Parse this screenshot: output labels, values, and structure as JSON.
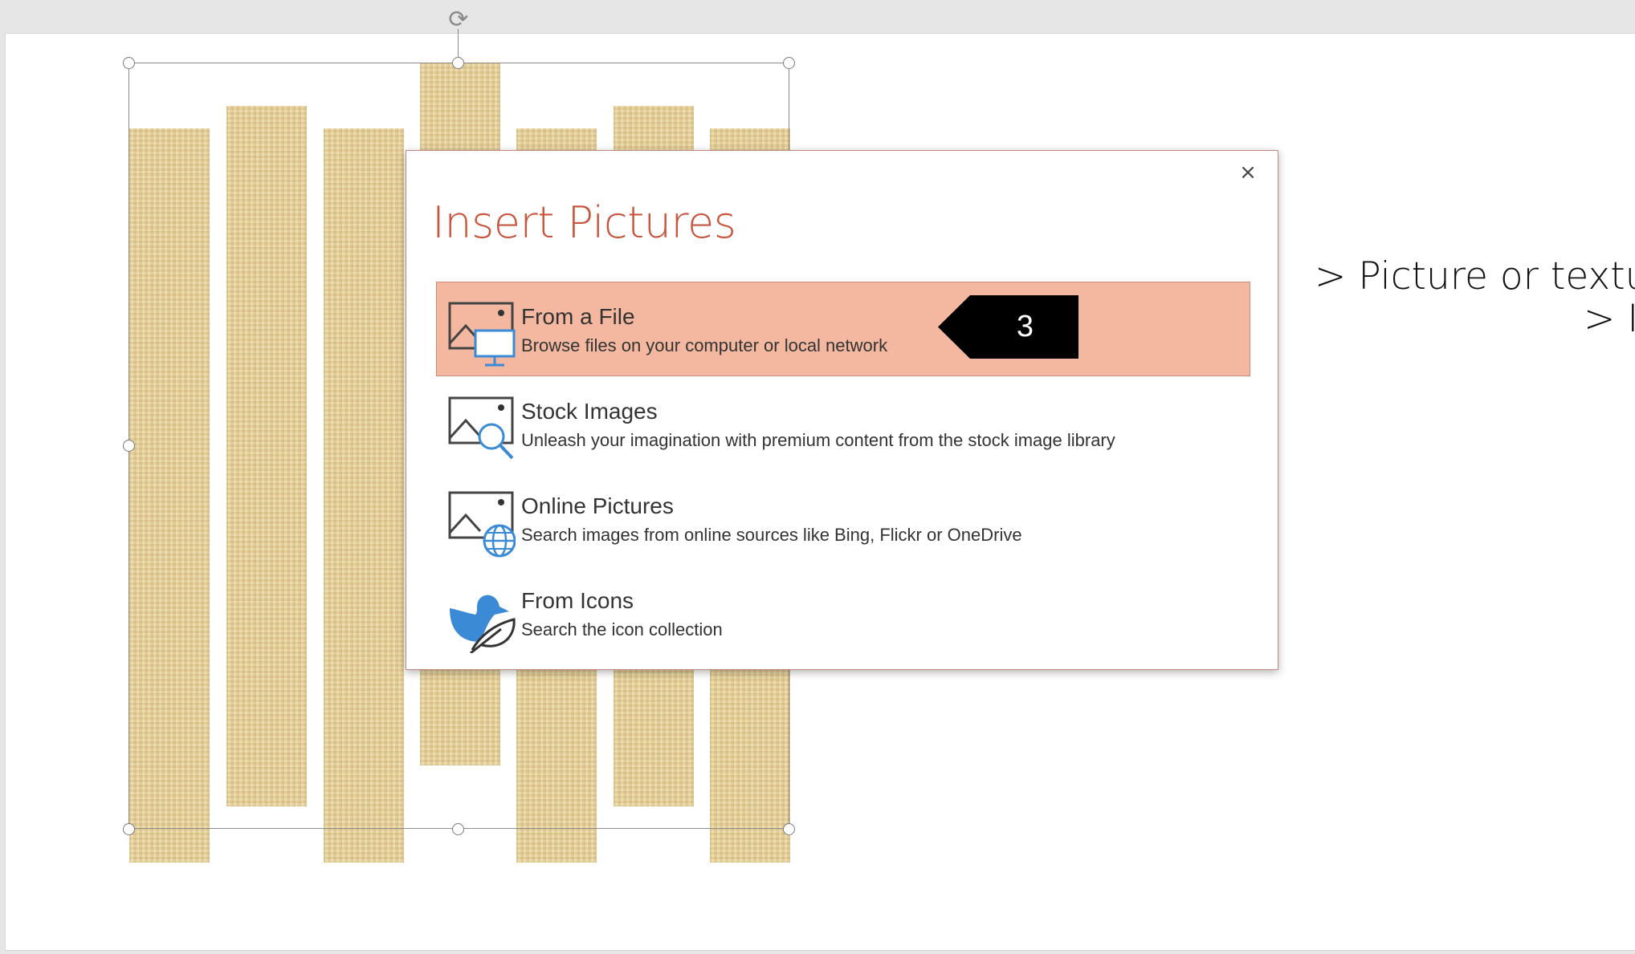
{
  "canvas": {
    "side_text_line1": "> Picture or textur",
    "side_text_line2": "> In"
  },
  "dialog": {
    "title": "Insert Pictures",
    "close_label": "×",
    "options": [
      {
        "title": "From a File",
        "description": "Browse files on your computer or local network",
        "icon": "picture-monitor-icon",
        "selected": true
      },
      {
        "title": "Stock Images",
        "description": "Unleash your imagination with premium content from the stock image library",
        "icon": "picture-search-icon",
        "selected": false
      },
      {
        "title": "Online Pictures",
        "description": "Search images from online sources like Bing, Flickr or OneDrive",
        "icon": "picture-globe-icon",
        "selected": false
      },
      {
        "title": "From Icons",
        "description": "Search the icon collection",
        "icon": "bird-leaf-icon",
        "selected": false
      }
    ]
  },
  "callout": {
    "label": "3"
  },
  "colors": {
    "title": "#c8553d",
    "selected_bg": "#f4b8a0",
    "icon_blue": "#3a8ad6",
    "papyrus": "#ead7a3"
  }
}
